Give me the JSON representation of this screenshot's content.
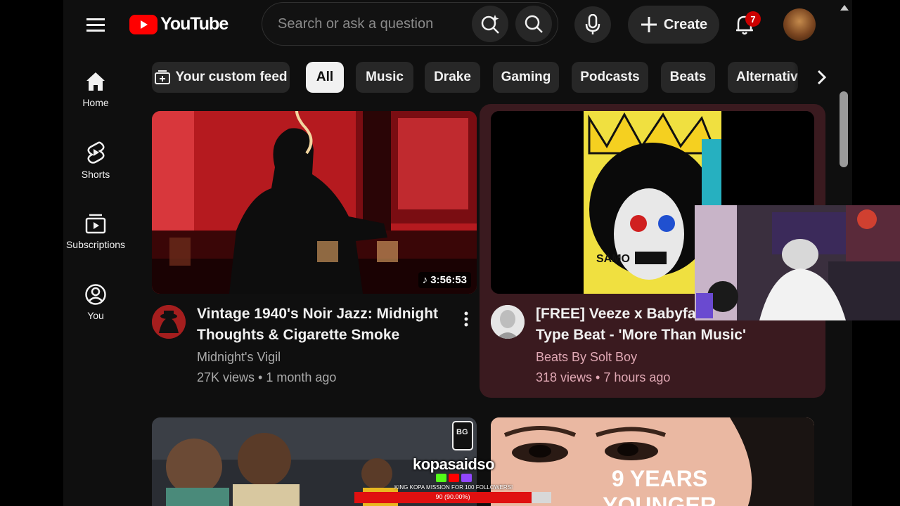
{
  "header": {
    "logo_text": "YouTube",
    "search_placeholder": "Search or ask a question",
    "create_label": "Create",
    "notification_count": "7"
  },
  "sidebar": {
    "items": [
      {
        "label": "Home",
        "icon": "home-icon"
      },
      {
        "label": "Shorts",
        "icon": "shorts-icon"
      },
      {
        "label": "Subscriptions",
        "icon": "subscriptions-icon"
      },
      {
        "label": "You",
        "icon": "you-icon"
      }
    ]
  },
  "chips": [
    {
      "label": "Your custom feed"
    },
    {
      "label": "All",
      "active": true
    },
    {
      "label": "Music"
    },
    {
      "label": "Drake"
    },
    {
      "label": "Gaming"
    },
    {
      "label": "Podcasts"
    },
    {
      "label": "Beats"
    },
    {
      "label": "Alternative"
    }
  ],
  "videos": [
    {
      "title": "Vintage 1940's Noir Jazz: Midnight Thoughts & Cigarette Smoke",
      "channel": "Midnight's Vigil",
      "meta": "27K views • 1 month ago",
      "duration": "3:56:53"
    },
    {
      "title": "[FREE] Veeze x Babyface Type Beat - 'More Than Music'",
      "channel": "Beats By Solt Boy",
      "meta": "318 views • 7 hours ago",
      "thumb_text": "SAMO"
    },
    {
      "thumb_text": "BG"
    },
    {
      "thumb_text": "9 YEARS YOUNGER"
    }
  ],
  "overlay": {
    "stream_name": "kopasaidso",
    "mission_text": "KING KOPA MISSION FOR 100 FOLLOWERS!",
    "progress_text": "90 (90.00%)",
    "progress": 0.9
  },
  "colors": {
    "background": "#0f0f0f",
    "chip": "#272727",
    "highlight": "#3a1a1f",
    "brand_red": "#ff0000",
    "channel_pink": "#e0a8b4"
  }
}
